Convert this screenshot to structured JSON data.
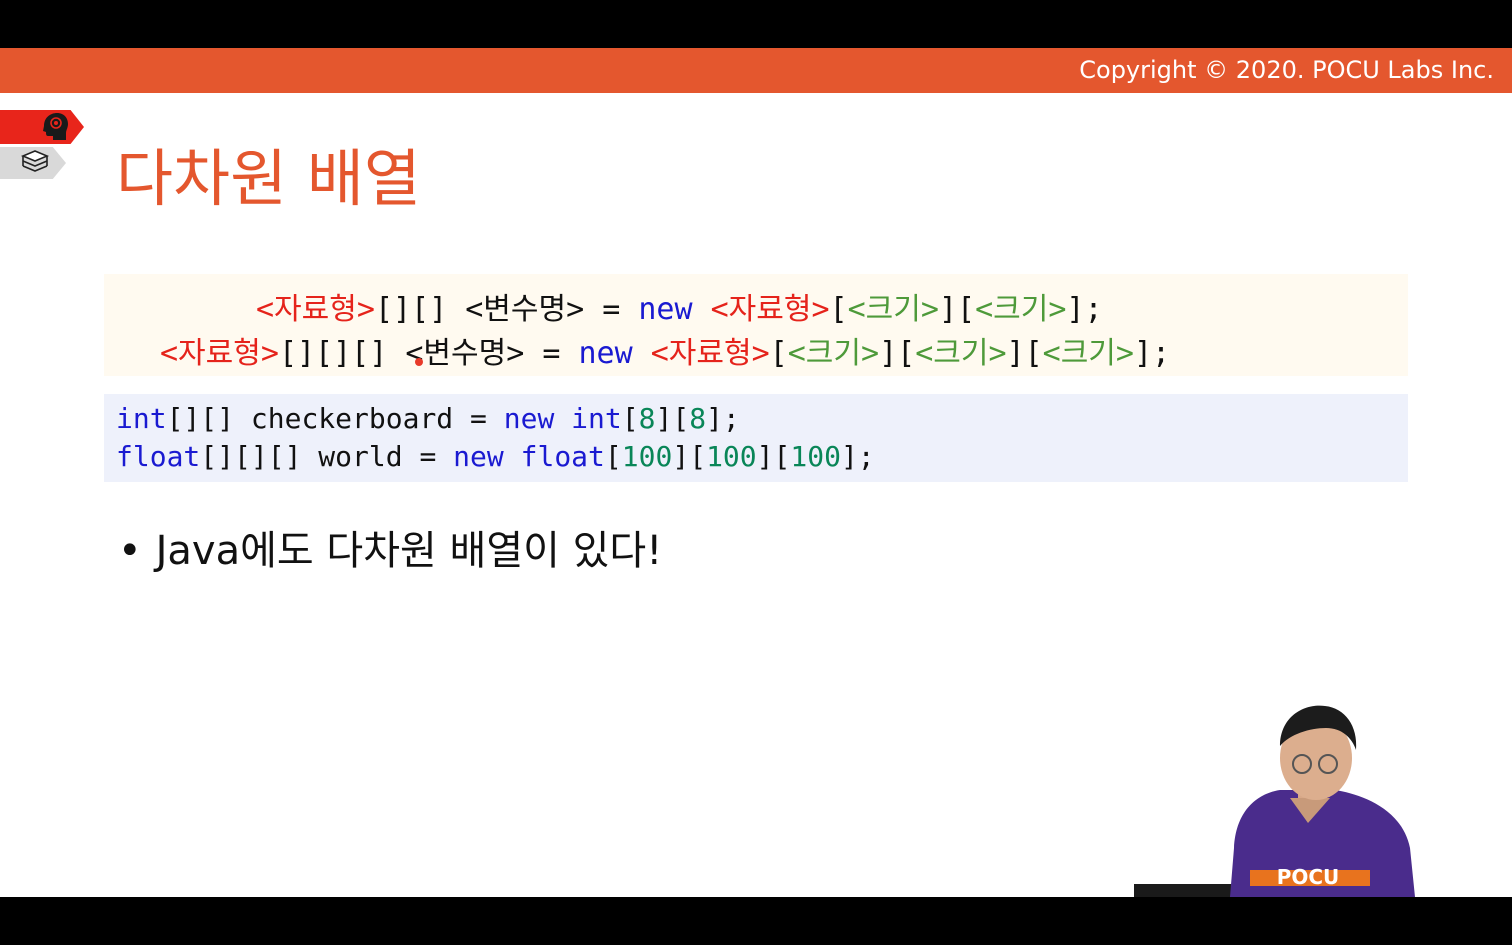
{
  "header": {
    "copyright": "Copyright © 2020. POCU Labs Inc."
  },
  "icons": {
    "top_tab": "brain-head-icon",
    "second_tab": "book-stack-icon"
  },
  "slide": {
    "title": "다차원 배열",
    "syntax": {
      "line1": [
        {
          "t": "<자료형>",
          "c": "red"
        },
        {
          "t": "[][] ",
          "c": "black"
        },
        {
          "t": "<변수명> = ",
          "c": "black"
        },
        {
          "t": "new ",
          "c": "blue"
        },
        {
          "t": "<자료형>",
          "c": "red"
        },
        {
          "t": "[",
          "c": "black"
        },
        {
          "t": "<크기>",
          "c": "green"
        },
        {
          "t": "][",
          "c": "black"
        },
        {
          "t": "<크기>",
          "c": "green"
        },
        {
          "t": "];",
          "c": "black"
        }
      ],
      "line2": [
        {
          "t": "<자료형>",
          "c": "red"
        },
        {
          "t": "[][][] ",
          "c": "black"
        },
        {
          "t": "<변수명> = ",
          "c": "black"
        },
        {
          "t": "new ",
          "c": "blue"
        },
        {
          "t": "<자료형>",
          "c": "red"
        },
        {
          "t": "[",
          "c": "black"
        },
        {
          "t": "<크기>",
          "c": "green"
        },
        {
          "t": "][",
          "c": "black"
        },
        {
          "t": "<크기>",
          "c": "green"
        },
        {
          "t": "][",
          "c": "black"
        },
        {
          "t": "<크기>",
          "c": "green"
        },
        {
          "t": "];",
          "c": "black"
        }
      ]
    },
    "code": {
      "line1": [
        {
          "t": "int",
          "c": "blue"
        },
        {
          "t": "[][] checkerboard = ",
          "c": "black"
        },
        {
          "t": "new ",
          "c": "blue"
        },
        {
          "t": "int",
          "c": "blue"
        },
        {
          "t": "[",
          "c": "black"
        },
        {
          "t": "8",
          "c": "teal"
        },
        {
          "t": "][",
          "c": "black"
        },
        {
          "t": "8",
          "c": "teal"
        },
        {
          "t": "];",
          "c": "black"
        }
      ],
      "line2": [
        {
          "t": "float",
          "c": "blue"
        },
        {
          "t": "[][][] world = ",
          "c": "black"
        },
        {
          "t": "new ",
          "c": "blue"
        },
        {
          "t": "float",
          "c": "blue"
        },
        {
          "t": "[",
          "c": "black"
        },
        {
          "t": "100",
          "c": "teal"
        },
        {
          "t": "][",
          "c": "black"
        },
        {
          "t": "100",
          "c": "teal"
        },
        {
          "t": "][",
          "c": "black"
        },
        {
          "t": "100",
          "c": "teal"
        },
        {
          "t": "];",
          "c": "black"
        }
      ]
    },
    "bullet": {
      "marker": "•",
      "text": "Java에도 다차원 배열이 있다!"
    },
    "presenter": {
      "shirt_logo": "POCU"
    }
  },
  "colors": {
    "accent": "#e4572e",
    "keyword": "#1a1ad1",
    "placeholder_type": "#e5231b",
    "placeholder_size": "#4e9a3a",
    "number": "#098658"
  }
}
